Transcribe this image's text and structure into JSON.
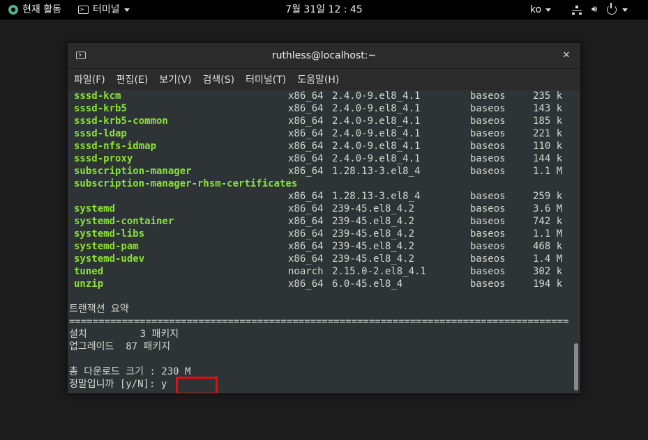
{
  "topbar": {
    "activities": "현재 활동",
    "app_menu": "터미널",
    "clock": "7월 31일  12 : 45",
    "language": "ko"
  },
  "window": {
    "title": "ruthless@localhost:~",
    "close_glyph": "✕"
  },
  "menu": [
    "파일(F)",
    "편집(E)",
    "보기(V)",
    "검색(S)",
    "터미널(T)",
    "도움말(H)"
  ],
  "packages": [
    {
      "name": "sssd-kcm",
      "arch": "x86_64",
      "version": "2.4.0-9.el8_4.1",
      "repo": "baseos",
      "size": "235 k"
    },
    {
      "name": "sssd-krb5",
      "arch": "x86_64",
      "version": "2.4.0-9.el8_4.1",
      "repo": "baseos",
      "size": "143 k"
    },
    {
      "name": "sssd-krb5-common",
      "arch": "x86_64",
      "version": "2.4.0-9.el8_4.1",
      "repo": "baseos",
      "size": "185 k"
    },
    {
      "name": "sssd-ldap",
      "arch": "x86_64",
      "version": "2.4.0-9.el8_4.1",
      "repo": "baseos",
      "size": "221 k"
    },
    {
      "name": "sssd-nfs-idmap",
      "arch": "x86_64",
      "version": "2.4.0-9.el8_4.1",
      "repo": "baseos",
      "size": "110 k"
    },
    {
      "name": "sssd-proxy",
      "arch": "x86_64",
      "version": "2.4.0-9.el8_4.1",
      "repo": "baseos",
      "size": "144 k"
    },
    {
      "name": "subscription-manager",
      "arch": "x86_64",
      "version": "1.28.13-3.el8_4",
      "repo": "baseos",
      "size": "1.1 M"
    },
    {
      "name": "subscription-manager-rhsm-certificates",
      "arch": "",
      "version": "",
      "repo": "",
      "size": ""
    },
    {
      "name": "",
      "arch": "x86_64",
      "version": "1.28.13-3.el8_4",
      "repo": "baseos",
      "size": "259 k"
    },
    {
      "name": "systemd",
      "arch": "x86_64",
      "version": "239-45.el8_4.2",
      "repo": "baseos",
      "size": "3.6 M"
    },
    {
      "name": "systemd-container",
      "arch": "x86_64",
      "version": "239-45.el8_4.2",
      "repo": "baseos",
      "size": "742 k"
    },
    {
      "name": "systemd-libs",
      "arch": "x86_64",
      "version": "239-45.el8_4.2",
      "repo": "baseos",
      "size": "1.1 M"
    },
    {
      "name": "systemd-pam",
      "arch": "x86_64",
      "version": "239-45.el8_4.2",
      "repo": "baseos",
      "size": "468 k"
    },
    {
      "name": "systemd-udev",
      "arch": "x86_64",
      "version": "239-45.el8_4.2",
      "repo": "baseos",
      "size": "1.4 M"
    },
    {
      "name": "tuned",
      "arch": "noarch",
      "version": "2.15.0-2.el8_4.1",
      "repo": "baseos",
      "size": "302 k"
    },
    {
      "name": "unzip",
      "arch": "x86_64",
      "version": "6.0-45.el8_4",
      "repo": "baseos",
      "size": "194 k"
    }
  ],
  "summary": {
    "heading": "트랜잭션 요약",
    "separator": "=====================================================================================",
    "install": "설치         3 패키지",
    "upgrade": "업그레이드  87 패키지",
    "total": "총 다운로드 크기 : 230 M",
    "prompt": "정말입니까 [y/N]: ",
    "answer": "y"
  }
}
